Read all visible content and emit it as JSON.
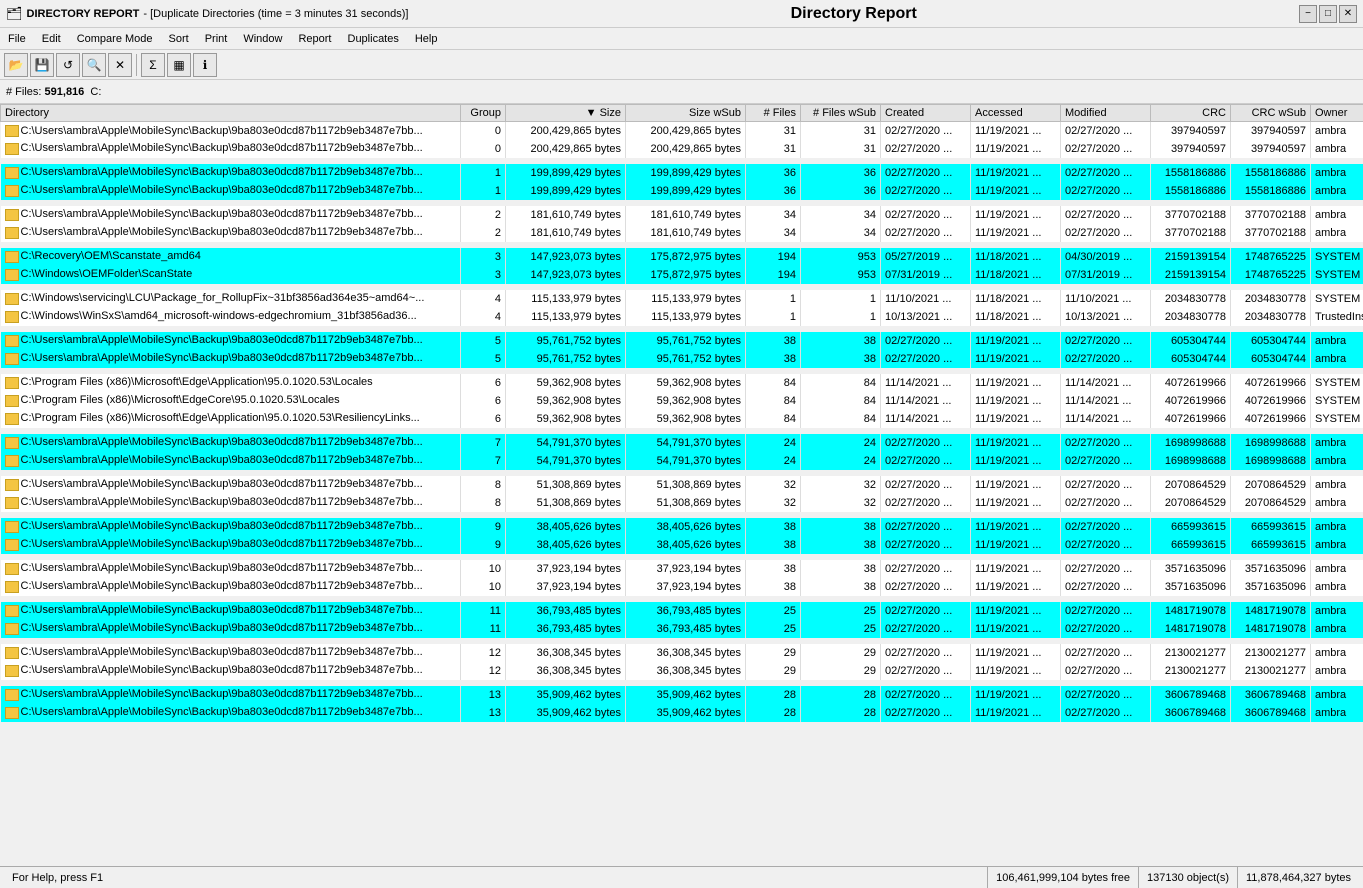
{
  "titleBar": {
    "appIcon": "folder-icon",
    "appName": "DIRECTORY REPORT",
    "windowTitle": "Duplicate Directories (time =  3 minutes 31 seconds)",
    "centerTitle": "Directory Report",
    "minBtn": "−",
    "maxBtn": "□",
    "closeBtn": "✕"
  },
  "menuBar": {
    "items": [
      "File",
      "Edit",
      "Compare Mode",
      "Sort",
      "Print",
      "Window",
      "Report",
      "Duplicates",
      "Help"
    ]
  },
  "statsBar": {
    "filesLabel": "# Files:",
    "filesValue": "591,816",
    "drive": "C:"
  },
  "columns": [
    "Directory",
    "Group",
    "▼ Size",
    "Size wSub",
    "# Files",
    "# Files wSub",
    "Created",
    "Accessed",
    "Modified",
    "CRC",
    "CRC wSub",
    "Owner"
  ],
  "rows": [
    {
      "group": "white",
      "cols": [
        "C:\\Users\\ambra\\Apple\\MobileSync\\Backup\\9ba803e0dcd87b1172b9eb3487e7bb...",
        "0",
        "200,429,865 bytes",
        "200,429,865 bytes",
        "31",
        "31",
        "02/27/2020 ...",
        "11/19/2021 ...",
        "02/27/2020 ...",
        "397940597",
        "397940597",
        "ambra"
      ]
    },
    {
      "group": "white",
      "cols": [
        "C:\\Users\\ambra\\Apple\\MobileSync\\Backup\\9ba803e0dcd87b1172b9eb3487e7bb...",
        "0",
        "200,429,865 bytes",
        "200,429,865 bytes",
        "31",
        "31",
        "02/27/2020 ...",
        "11/19/2021 ...",
        "02/27/2020 ...",
        "397940597",
        "397940597",
        "ambra"
      ]
    },
    {
      "group": "spacer"
    },
    {
      "group": "cyan",
      "cols": [
        "C:\\Users\\ambra\\Apple\\MobileSync\\Backup\\9ba803e0dcd87b1172b9eb3487e7bb...",
        "1",
        "199,899,429 bytes",
        "199,899,429 bytes",
        "36",
        "36",
        "02/27/2020 ...",
        "11/19/2021 ...",
        "02/27/2020 ...",
        "1558186886",
        "1558186886",
        "ambra"
      ]
    },
    {
      "group": "cyan",
      "cols": [
        "C:\\Users\\ambra\\Apple\\MobileSync\\Backup\\9ba803e0dcd87b1172b9eb3487e7bb...",
        "1",
        "199,899,429 bytes",
        "199,899,429 bytes",
        "36",
        "36",
        "02/27/2020 ...",
        "11/19/2021 ...",
        "02/27/2020 ...",
        "1558186886",
        "1558186886",
        "ambra"
      ]
    },
    {
      "group": "spacer"
    },
    {
      "group": "white",
      "cols": [
        "C:\\Users\\ambra\\Apple\\MobileSync\\Backup\\9ba803e0dcd87b1172b9eb3487e7bb...",
        "2",
        "181,610,749 bytes",
        "181,610,749 bytes",
        "34",
        "34",
        "02/27/2020 ...",
        "11/19/2021 ...",
        "02/27/2020 ...",
        "3770702188",
        "3770702188",
        "ambra"
      ]
    },
    {
      "group": "white",
      "cols": [
        "C:\\Users\\ambra\\Apple\\MobileSync\\Backup\\9ba803e0dcd87b1172b9eb3487e7bb...",
        "2",
        "181,610,749 bytes",
        "181,610,749 bytes",
        "34",
        "34",
        "02/27/2020 ...",
        "11/19/2021 ...",
        "02/27/2020 ...",
        "3770702188",
        "3770702188",
        "ambra"
      ]
    },
    {
      "group": "spacer"
    },
    {
      "group": "cyan",
      "cols": [
        "C:\\Recovery\\OEM\\Scanstate_amd64",
        "3",
        "147,923,073 bytes",
        "175,872,975 bytes",
        "194",
        "953",
        "05/27/2019 ...",
        "11/18/2021 ...",
        "04/30/2019 ...",
        "2159139154",
        "1748765225",
        "SYSTEM"
      ]
    },
    {
      "group": "cyan",
      "cols": [
        "C:\\Windows\\OEMFolder\\ScanState",
        "3",
        "147,923,073 bytes",
        "175,872,975 bytes",
        "194",
        "953",
        "07/31/2019 ...",
        "11/18/2021 ...",
        "07/31/2019 ...",
        "2159139154",
        "1748765225",
        "SYSTEM"
      ]
    },
    {
      "group": "spacer"
    },
    {
      "group": "white",
      "cols": [
        "C:\\Windows\\servicing\\LCU\\Package_for_RollupFix~31bf3856ad364e35~amd64~...",
        "4",
        "115,133,979 bytes",
        "115,133,979 bytes",
        "1",
        "1",
        "11/10/2021 ...",
        "11/18/2021 ...",
        "11/10/2021 ...",
        "2034830778",
        "2034830778",
        "SYSTEM"
      ]
    },
    {
      "group": "white",
      "cols": [
        "C:\\Windows\\WinSxS\\amd64_microsoft-windows-edgechromium_31bf3856ad36...",
        "4",
        "115,133,979 bytes",
        "115,133,979 bytes",
        "1",
        "1",
        "10/13/2021 ...",
        "11/18/2021 ...",
        "10/13/2021 ...",
        "2034830778",
        "2034830778",
        "TrustedInstaller"
      ]
    },
    {
      "group": "spacer"
    },
    {
      "group": "cyan",
      "cols": [
        "C:\\Users\\ambra\\Apple\\MobileSync\\Backup\\9ba803e0dcd87b1172b9eb3487e7bb...",
        "5",
        "95,761,752 bytes",
        "95,761,752 bytes",
        "38",
        "38",
        "02/27/2020 ...",
        "11/19/2021 ...",
        "02/27/2020 ...",
        "605304744",
        "605304744",
        "ambra"
      ]
    },
    {
      "group": "cyan",
      "cols": [
        "C:\\Users\\ambra\\Apple\\MobileSync\\Backup\\9ba803e0dcd87b1172b9eb3487e7bb...",
        "5",
        "95,761,752 bytes",
        "95,761,752 bytes",
        "38",
        "38",
        "02/27/2020 ...",
        "11/19/2021 ...",
        "02/27/2020 ...",
        "605304744",
        "605304744",
        "ambra"
      ]
    },
    {
      "group": "spacer"
    },
    {
      "group": "white",
      "cols": [
        "C:\\Program Files (x86)\\Microsoft\\Edge\\Application\\95.0.1020.53\\Locales",
        "6",
        "59,362,908 bytes",
        "59,362,908 bytes",
        "84",
        "84",
        "11/14/2021 ...",
        "11/19/2021 ...",
        "11/14/2021 ...",
        "4072619966",
        "4072619966",
        "SYSTEM"
      ]
    },
    {
      "group": "white",
      "cols": [
        "C:\\Program Files (x86)\\Microsoft\\EdgeCore\\95.0.1020.53\\Locales",
        "6",
        "59,362,908 bytes",
        "59,362,908 bytes",
        "84",
        "84",
        "11/14/2021 ...",
        "11/19/2021 ...",
        "11/14/2021 ...",
        "4072619966",
        "4072619966",
        "SYSTEM"
      ]
    },
    {
      "group": "white",
      "cols": [
        "C:\\Program Files (x86)\\Microsoft\\Edge\\Application\\95.0.1020.53\\ResiliencyLinks...",
        "6",
        "59,362,908 bytes",
        "59,362,908 bytes",
        "84",
        "84",
        "11/14/2021 ...",
        "11/19/2021 ...",
        "11/14/2021 ...",
        "4072619966",
        "4072619966",
        "SYSTEM"
      ]
    },
    {
      "group": "spacer"
    },
    {
      "group": "cyan",
      "cols": [
        "C:\\Users\\ambra\\Apple\\MobileSync\\Backup\\9ba803e0dcd87b1172b9eb3487e7bb...",
        "7",
        "54,791,370 bytes",
        "54,791,370 bytes",
        "24",
        "24",
        "02/27/2020 ...",
        "11/19/2021 ...",
        "02/27/2020 ...",
        "1698998688",
        "1698998688",
        "ambra"
      ]
    },
    {
      "group": "cyan",
      "cols": [
        "C:\\Users\\ambra\\Apple\\MobileSync\\Backup\\9ba803e0dcd87b1172b9eb3487e7bb...",
        "7",
        "54,791,370 bytes",
        "54,791,370 bytes",
        "24",
        "24",
        "02/27/2020 ...",
        "11/19/2021 ...",
        "02/27/2020 ...",
        "1698998688",
        "1698998688",
        "ambra"
      ]
    },
    {
      "group": "spacer"
    },
    {
      "group": "white",
      "cols": [
        "C:\\Users\\ambra\\Apple\\MobileSync\\Backup\\9ba803e0dcd87b1172b9eb3487e7bb...",
        "8",
        "51,308,869 bytes",
        "51,308,869 bytes",
        "32",
        "32",
        "02/27/2020 ...",
        "11/19/2021 ...",
        "02/27/2020 ...",
        "2070864529",
        "2070864529",
        "ambra"
      ]
    },
    {
      "group": "white",
      "cols": [
        "C:\\Users\\ambra\\Apple\\MobileSync\\Backup\\9ba803e0dcd87b1172b9eb3487e7bb...",
        "8",
        "51,308,869 bytes",
        "51,308,869 bytes",
        "32",
        "32",
        "02/27/2020 ...",
        "11/19/2021 ...",
        "02/27/2020 ...",
        "2070864529",
        "2070864529",
        "ambra"
      ]
    },
    {
      "group": "spacer"
    },
    {
      "group": "cyan",
      "cols": [
        "C:\\Users\\ambra\\Apple\\MobileSync\\Backup\\9ba803e0dcd87b1172b9eb3487e7bb...",
        "9",
        "38,405,626 bytes",
        "38,405,626 bytes",
        "38",
        "38",
        "02/27/2020 ...",
        "11/19/2021 ...",
        "02/27/2020 ...",
        "665993615",
        "665993615",
        "ambra"
      ]
    },
    {
      "group": "cyan",
      "cols": [
        "C:\\Users\\ambra\\Apple\\MobileSync\\Backup\\9ba803e0dcd87b1172b9eb3487e7bb...",
        "9",
        "38,405,626 bytes",
        "38,405,626 bytes",
        "38",
        "38",
        "02/27/2020 ...",
        "11/19/2021 ...",
        "02/27/2020 ...",
        "665993615",
        "665993615",
        "ambra"
      ]
    },
    {
      "group": "spacer"
    },
    {
      "group": "white",
      "cols": [
        "C:\\Users\\ambra\\Apple\\MobileSync\\Backup\\9ba803e0dcd87b1172b9eb3487e7bb...",
        "10",
        "37,923,194 bytes",
        "37,923,194 bytes",
        "38",
        "38",
        "02/27/2020 ...",
        "11/19/2021 ...",
        "02/27/2020 ...",
        "3571635096",
        "3571635096",
        "ambra"
      ]
    },
    {
      "group": "white",
      "cols": [
        "C:\\Users\\ambra\\Apple\\MobileSync\\Backup\\9ba803e0dcd87b1172b9eb3487e7bb...",
        "10",
        "37,923,194 bytes",
        "37,923,194 bytes",
        "38",
        "38",
        "02/27/2020 ...",
        "11/19/2021 ...",
        "02/27/2020 ...",
        "3571635096",
        "3571635096",
        "ambra"
      ]
    },
    {
      "group": "spacer"
    },
    {
      "group": "cyan",
      "cols": [
        "C:\\Users\\ambra\\Apple\\MobileSync\\Backup\\9ba803e0dcd87b1172b9eb3487e7bb...",
        "11",
        "36,793,485 bytes",
        "36,793,485 bytes",
        "25",
        "25",
        "02/27/2020 ...",
        "11/19/2021 ...",
        "02/27/2020 ...",
        "1481719078",
        "1481719078",
        "ambra"
      ]
    },
    {
      "group": "cyan",
      "cols": [
        "C:\\Users\\ambra\\Apple\\MobileSync\\Backup\\9ba803e0dcd87b1172b9eb3487e7bb...",
        "11",
        "36,793,485 bytes",
        "36,793,485 bytes",
        "25",
        "25",
        "02/27/2020 ...",
        "11/19/2021 ...",
        "02/27/2020 ...",
        "1481719078",
        "1481719078",
        "ambra"
      ]
    },
    {
      "group": "spacer"
    },
    {
      "group": "white",
      "cols": [
        "C:\\Users\\ambra\\Apple\\MobileSync\\Backup\\9ba803e0dcd87b1172b9eb3487e7bb...",
        "12",
        "36,308,345 bytes",
        "36,308,345 bytes",
        "29",
        "29",
        "02/27/2020 ...",
        "11/19/2021 ...",
        "02/27/2020 ...",
        "2130021277",
        "2130021277",
        "ambra"
      ]
    },
    {
      "group": "white",
      "cols": [
        "C:\\Users\\ambra\\Apple\\MobileSync\\Backup\\9ba803e0dcd87b1172b9eb3487e7bb...",
        "12",
        "36,308,345 bytes",
        "36,308,345 bytes",
        "29",
        "29",
        "02/27/2020 ...",
        "11/19/2021 ...",
        "02/27/2020 ...",
        "2130021277",
        "2130021277",
        "ambra"
      ]
    },
    {
      "group": "spacer"
    },
    {
      "group": "cyan",
      "cols": [
        "C:\\Users\\ambra\\Apple\\MobileSync\\Backup\\9ba803e0dcd87b1172b9eb3487e7bb...",
        "13",
        "35,909,462 bytes",
        "35,909,462 bytes",
        "28",
        "28",
        "02/27/2020 ...",
        "11/19/2021 ...",
        "02/27/2020 ...",
        "3606789468",
        "3606789468",
        "ambra"
      ]
    },
    {
      "group": "cyan",
      "cols": [
        "C:\\Users\\ambra\\Apple\\MobileSync\\Backup\\9ba803e0dcd87b1172b9eb3487e7bb...",
        "13",
        "35,909,462 bytes",
        "35,909,462 bytes",
        "28",
        "28",
        "02/27/2020 ...",
        "11/19/2021 ...",
        "02/27/2020 ...",
        "3606789468",
        "3606789468",
        "ambra"
      ]
    }
  ],
  "statusBar": {
    "help": "For Help, press F1",
    "freeSpace": "106,461,999,104 bytes free",
    "objects": "137130 object(s)",
    "totalBytes": "11,878,464,327 bytes"
  }
}
